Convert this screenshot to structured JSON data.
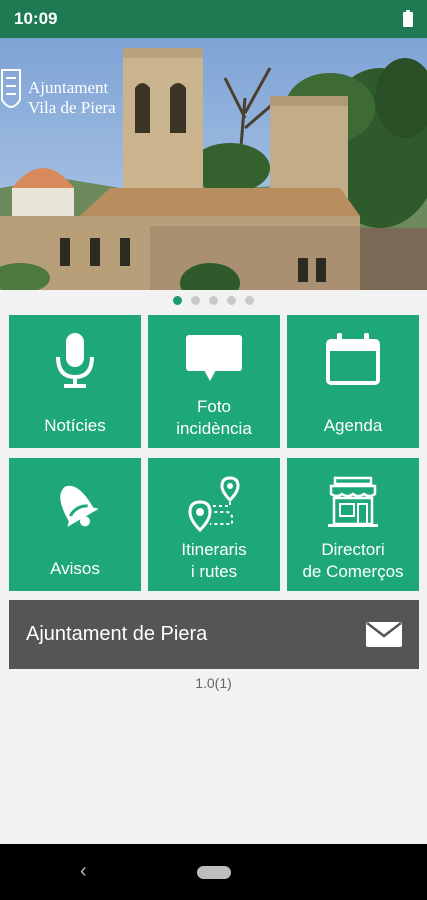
{
  "status_bar": {
    "time": "10:09",
    "battery_icon": "battery-full-icon"
  },
  "hero": {
    "logo_line1": "Ajuntament",
    "logo_line2": "Vila de Piera"
  },
  "carousel": {
    "pages": 5,
    "active": 1
  },
  "tiles": [
    {
      "label": "Notícies",
      "icon": "microphone-icon"
    },
    {
      "label": "Foto incidència",
      "line1": "Foto",
      "line2": "incidència",
      "icon": "speech-bubble-icon"
    },
    {
      "label": "Agenda",
      "icon": "calendar-icon"
    },
    {
      "label": "Avisos",
      "icon": "bell-icon"
    },
    {
      "label": "Itineraris i rutes",
      "line1": "Itineraris",
      "line2": "i rutes",
      "icon": "route-map-icon"
    },
    {
      "label": "Directori de Comerços",
      "line1": "Directori",
      "line2": "de Comerços",
      "icon": "shop-icon"
    }
  ],
  "contact": {
    "title": "Ajuntament de Piera",
    "icon": "mail-icon"
  },
  "version": "1.0(1)",
  "colors": {
    "status_bar": "#1d7a52",
    "tile": "#1ea878",
    "footer_bar": "#555555",
    "active_dot": "#1f9c6b"
  }
}
